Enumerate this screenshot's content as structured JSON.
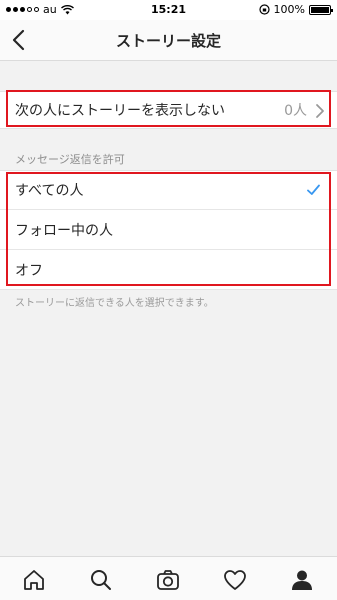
{
  "status": {
    "carrier": "au",
    "time": "15:21",
    "battery": "100%"
  },
  "nav": {
    "title": "ストーリー設定"
  },
  "hide": {
    "label": "次の人にストーリーを表示しない",
    "value": "0人"
  },
  "replies": {
    "section_label": "メッセージ返信を許可",
    "options": [
      {
        "label": "すべての人",
        "selected": true
      },
      {
        "label": "フォロー中の人",
        "selected": false
      },
      {
        "label": "オフ",
        "selected": false
      }
    ],
    "hint": "ストーリーに返信できる人を選択できます。"
  },
  "tabs": [
    "home-icon",
    "search-icon",
    "camera-icon",
    "heart-icon",
    "profile-icon"
  ],
  "colors": {
    "highlight": "#e0171f",
    "check": "#3897f0"
  }
}
